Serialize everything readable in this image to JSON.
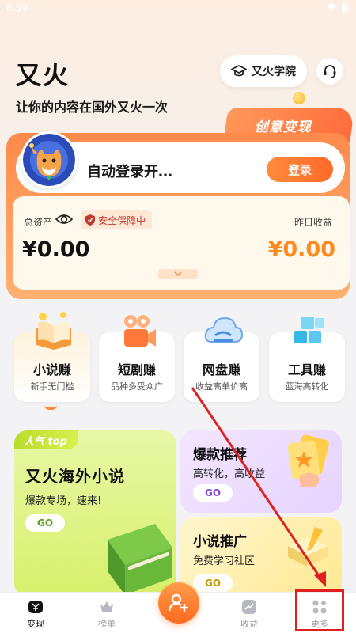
{
  "status_bar": {
    "time": "8:59"
  },
  "header": {
    "app_title": "又火",
    "subtitle": "让你的内容在国外又火一次",
    "academy_label": "又火学院"
  },
  "promo_tag": "创意变现",
  "account": {
    "login_prompt": "自动登录开…",
    "login_button": "登录",
    "total_assets_label": "总资产",
    "safety_badge": "安全保障中",
    "yesterday_label": "昨日收益",
    "total_assets_value": "¥0.00",
    "yesterday_value": "¥0.00"
  },
  "categories": [
    {
      "name": "小说赚",
      "sub": "新手无门槛"
    },
    {
      "name": "短剧赚",
      "sub": "品种多受众广"
    },
    {
      "name": "网盘赚",
      "sub": "收益高单价高"
    },
    {
      "name": "工具赚",
      "sub": "蓝海高转化"
    }
  ],
  "banners": {
    "big": {
      "tag": "人气 top",
      "title": "又火海外小说",
      "sub": "爆款专场，速来!",
      "go": "GO"
    },
    "right1": {
      "title": "爆款推荐",
      "sub": "高转化，高收益",
      "go": "GO"
    },
    "right2": {
      "title": "小说推广",
      "sub": "免费学习社区",
      "go": "GO"
    }
  },
  "bottom_nav": [
    {
      "label": "变现"
    },
    {
      "label": "榜单"
    },
    {
      "label": "收益"
    },
    {
      "label": "更多"
    }
  ],
  "colors": {
    "accent": "#ff7a2e",
    "highlight": "#e02020"
  }
}
